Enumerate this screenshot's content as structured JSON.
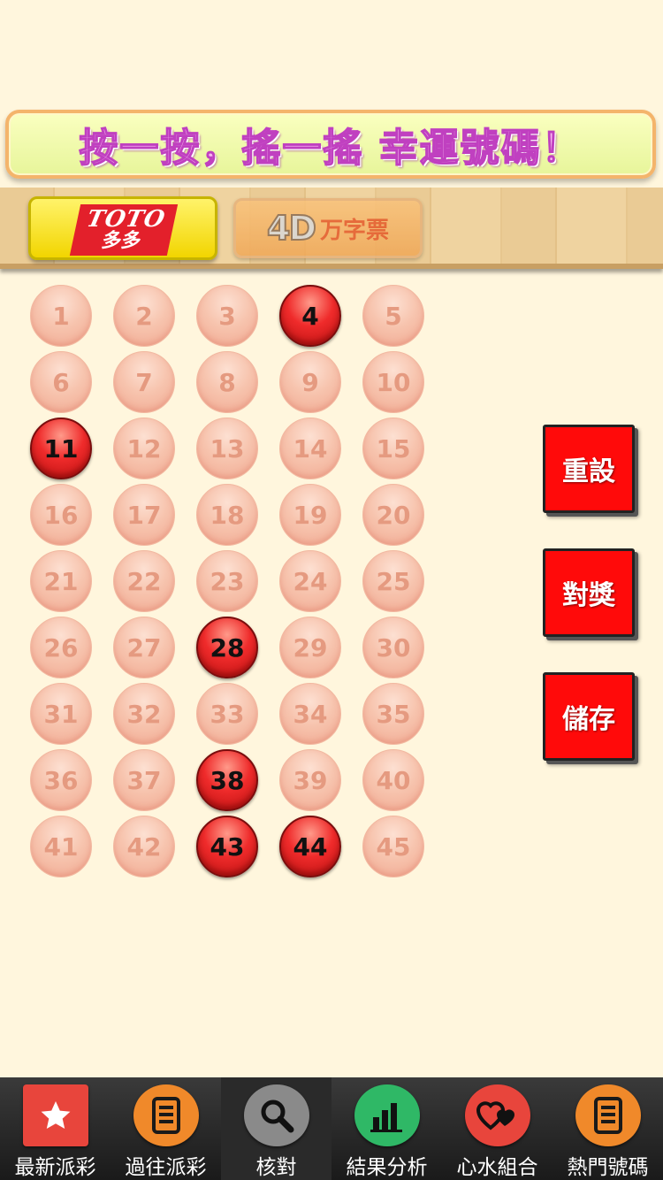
{
  "banner": {
    "text": "按一按，搖一搖  幸運號碼！"
  },
  "tabs": {
    "toto": {
      "line1": "TOTO",
      "line2": "多多"
    },
    "fourd": {
      "mark": "4D",
      "label": "万字票"
    }
  },
  "balls": [
    {
      "n": "1",
      "selected": false
    },
    {
      "n": "2",
      "selected": false
    },
    {
      "n": "3",
      "selected": false
    },
    {
      "n": "4",
      "selected": true
    },
    {
      "n": "5",
      "selected": false
    },
    {
      "n": "6",
      "selected": false
    },
    {
      "n": "7",
      "selected": false
    },
    {
      "n": "8",
      "selected": false
    },
    {
      "n": "9",
      "selected": false
    },
    {
      "n": "10",
      "selected": false
    },
    {
      "n": "11",
      "selected": true
    },
    {
      "n": "12",
      "selected": false
    },
    {
      "n": "13",
      "selected": false
    },
    {
      "n": "14",
      "selected": false
    },
    {
      "n": "15",
      "selected": false
    },
    {
      "n": "16",
      "selected": false
    },
    {
      "n": "17",
      "selected": false
    },
    {
      "n": "18",
      "selected": false
    },
    {
      "n": "19",
      "selected": false
    },
    {
      "n": "20",
      "selected": false
    },
    {
      "n": "21",
      "selected": false
    },
    {
      "n": "22",
      "selected": false
    },
    {
      "n": "23",
      "selected": false
    },
    {
      "n": "24",
      "selected": false
    },
    {
      "n": "25",
      "selected": false
    },
    {
      "n": "26",
      "selected": false
    },
    {
      "n": "27",
      "selected": false
    },
    {
      "n": "28",
      "selected": true
    },
    {
      "n": "29",
      "selected": false
    },
    {
      "n": "30",
      "selected": false
    },
    {
      "n": "31",
      "selected": false
    },
    {
      "n": "32",
      "selected": false
    },
    {
      "n": "33",
      "selected": false
    },
    {
      "n": "34",
      "selected": false
    },
    {
      "n": "35",
      "selected": false
    },
    {
      "n": "36",
      "selected": false
    },
    {
      "n": "37",
      "selected": false
    },
    {
      "n": "38",
      "selected": true
    },
    {
      "n": "39",
      "selected": false
    },
    {
      "n": "40",
      "selected": false
    },
    {
      "n": "41",
      "selected": false
    },
    {
      "n": "42",
      "selected": false
    },
    {
      "n": "43",
      "selected": true
    },
    {
      "n": "44",
      "selected": true
    },
    {
      "n": "45",
      "selected": false
    }
  ],
  "actions": {
    "reset": "重設",
    "check": "對獎",
    "save": "儲存"
  },
  "nav": [
    {
      "label": "最新派彩",
      "icon": "star-icon",
      "color": "#e8453c"
    },
    {
      "label": "過往派彩",
      "icon": "list-icon",
      "color": "#f0892a"
    },
    {
      "label": "核對",
      "icon": "magnifier-icon",
      "color": "#8a8a8a"
    },
    {
      "label": "結果分析",
      "icon": "bar-chart-icon",
      "color": "#2fb866"
    },
    {
      "label": "心水組合",
      "icon": "hearts-icon",
      "color": "#e8453c"
    },
    {
      "label": "熱門號碼",
      "icon": "list-icon",
      "color": "#f0892a"
    }
  ],
  "colors": {
    "background": "#fff6dd",
    "selected_ball": "#ef2b2b",
    "action_button": "#ff0a0a"
  }
}
